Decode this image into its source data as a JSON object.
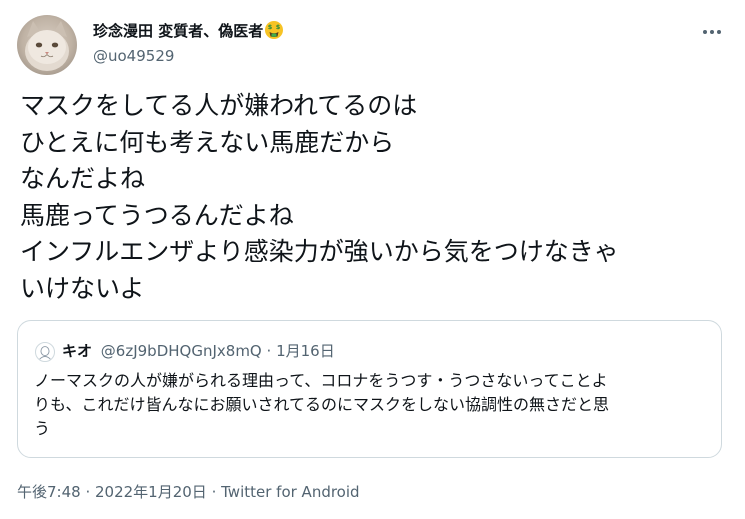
{
  "author": {
    "display_name": "珍念漫田 変質者、偽医者",
    "emoji_icon": "money-mouth-face-icon",
    "handle": "@uo49529"
  },
  "tweet": {
    "lines": [
      "マスクをしてる人が嫌われてるのは",
      "ひとえに何も考えない馬鹿だから",
      "なんだよね",
      "馬鹿ってうつるんだよね",
      "インフルエンザより感染力が強いから気をつけなきゃ",
      "いけないよ"
    ]
  },
  "quote": {
    "name": "キオ",
    "handle": "@6zJ9bDHQGnJx8mQ",
    "separator": "·",
    "date": "1月16日",
    "lines": [
      "ノーマスクの人が嫌がられる理由って、コロナをうつす・うつさないってことよ",
      "りも、これだけ皆んなにお願いされてるのにマスクをしない協調性の無さだと思",
      "う"
    ]
  },
  "meta": {
    "time": "午後7:48",
    "separator1": " · ",
    "date": "2022年1月20日",
    "separator2": " · ",
    "source": "Twitter for Android"
  },
  "colors": {
    "text_primary": "#0f1419",
    "text_secondary": "#536471",
    "border": "#cfd9de"
  }
}
